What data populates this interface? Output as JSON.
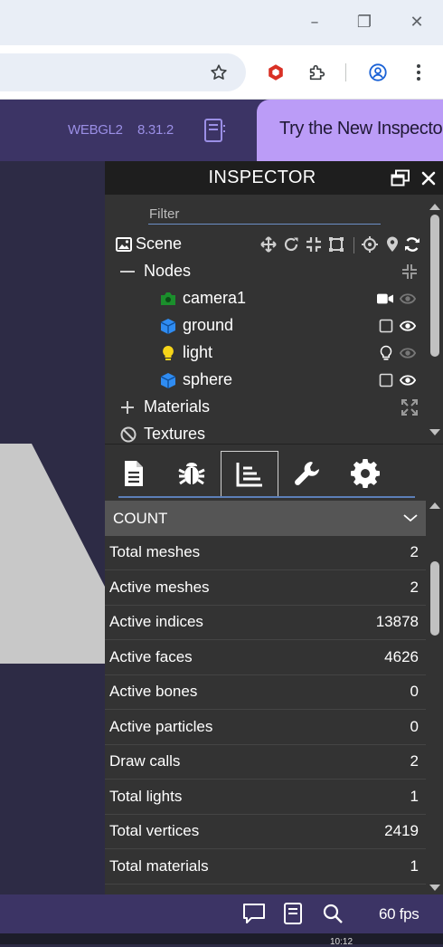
{
  "window_controls": [
    "–",
    "❐",
    "✕"
  ],
  "topbar": {
    "webgl": "WEBGL2",
    "version": "8.31.2",
    "try_button": "Try the New Inspector"
  },
  "inspector": {
    "title": "INSPECTOR",
    "filter_placeholder": "Filter",
    "tree": {
      "scene": "Scene",
      "nodes": "Nodes",
      "children": [
        {
          "label": "camera1",
          "icon": "camera-icon",
          "color": "#1b8f2c"
        },
        {
          "label": "ground",
          "icon": "cube-icon",
          "color": "#2f8cf2"
        },
        {
          "label": "light",
          "icon": "bulb-icon",
          "color": "#f6d519"
        },
        {
          "label": "sphere",
          "icon": "cube-icon",
          "color": "#2f8cf2"
        }
      ],
      "materials": "Materials",
      "textures": "Textures"
    },
    "tabs": [
      "properties",
      "debug",
      "statistics",
      "tools",
      "settings"
    ],
    "selected_tab": "statistics",
    "stats": {
      "section": "COUNT",
      "rows": [
        {
          "label": "Total meshes",
          "value": "2"
        },
        {
          "label": "Active meshes",
          "value": "2"
        },
        {
          "label": "Active indices",
          "value": "13878"
        },
        {
          "label": "Active faces",
          "value": "4626"
        },
        {
          "label": "Active bones",
          "value": "0"
        },
        {
          "label": "Active particles",
          "value": "0"
        },
        {
          "label": "Draw calls",
          "value": "2"
        },
        {
          "label": "Total lights",
          "value": "1"
        },
        {
          "label": "Total vertices",
          "value": "2419"
        },
        {
          "label": "Total materials",
          "value": "1"
        }
      ]
    }
  },
  "bottom": {
    "fps": "60 fps",
    "clock": "10:12"
  },
  "colors": {
    "accent": "#bb9cf7",
    "bar": "#3c3465",
    "panel": "#333333"
  }
}
